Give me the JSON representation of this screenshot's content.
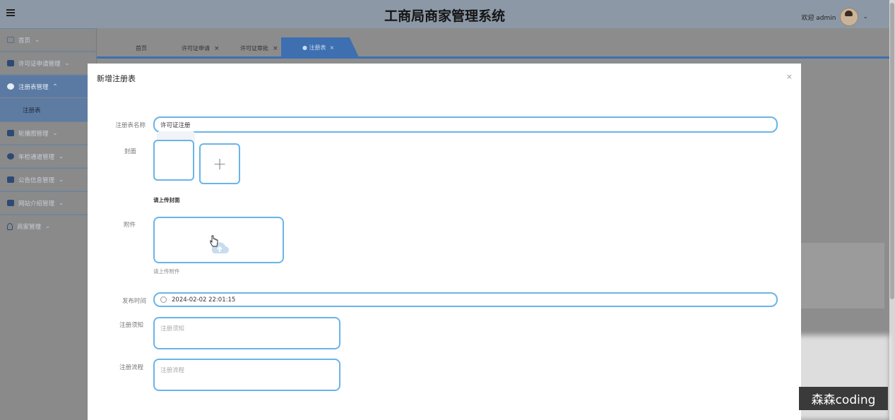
{
  "header": {
    "title": "工商局商家管理系统",
    "welcome": "欢迎 admin"
  },
  "sidebar": {
    "items": [
      {
        "label": "首页",
        "icon": "home-icon"
      },
      {
        "label": "许可证申请管理",
        "icon": "chart-icon"
      },
      {
        "label": "注册表管理",
        "icon": "plus-circle-icon"
      },
      {
        "label": "轮播图管理",
        "icon": "printer-icon"
      },
      {
        "label": "年检通道管理",
        "icon": "circle-icon"
      },
      {
        "label": "公告信息管理",
        "icon": "copy-icon"
      },
      {
        "label": "网站介绍管理",
        "icon": "grid-icon"
      },
      {
        "label": "商家管理",
        "icon": "person-icon"
      }
    ],
    "sub_items": [
      {
        "label": "注册表"
      }
    ]
  },
  "tabs": [
    {
      "label": "首页"
    },
    {
      "label": "许可证申请",
      "close": "×"
    },
    {
      "label": "许可证审批",
      "close": "×"
    },
    {
      "label": "● 注册表",
      "close": "×",
      "active": true
    }
  ],
  "modal": {
    "title": "新增注册表",
    "close": "×",
    "fields": {
      "name": {
        "label": "注册表名称",
        "value": "许可证注册"
      },
      "cover": {
        "label": "封面",
        "hint": "请上传封面",
        "add": "+"
      },
      "attachment": {
        "label": "附件",
        "hint": "请上传附件"
      },
      "publish_time": {
        "label": "发布时间",
        "value": "2024-02-02 22:01:15"
      },
      "notice": {
        "label": "注册须知",
        "placeholder": "注册须知"
      },
      "process": {
        "label": "注册流程",
        "placeholder": "注册流程"
      }
    }
  },
  "watermark": "森森coding",
  "colors": {
    "accent": "#3e6fb0",
    "input_border": "#6ab4e8",
    "overlay": "#8d8d8d"
  }
}
